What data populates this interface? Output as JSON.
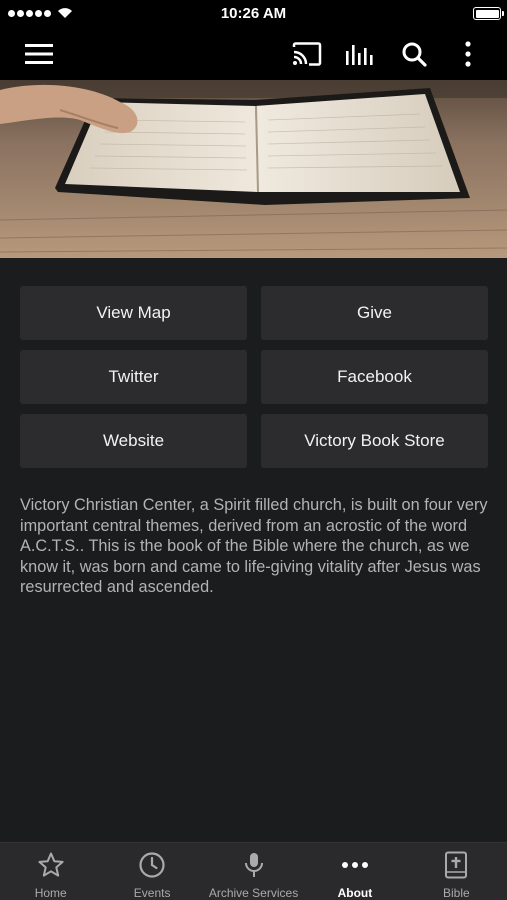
{
  "status_bar": {
    "time": "10:26 AM"
  },
  "toolbar": {
    "icons": [
      "menu-icon",
      "cast-icon",
      "audio-bars-icon",
      "search-icon",
      "more-vertical-icon"
    ]
  },
  "hero": {
    "description": "photo of an open Bible on a wooden table"
  },
  "buttons": [
    {
      "label": "View Map"
    },
    {
      "label": "Give"
    },
    {
      "label": "Twitter"
    },
    {
      "label": "Facebook"
    },
    {
      "label": "Website"
    },
    {
      "label": "Victory Book Store"
    }
  ],
  "about_text": "Victory Christian Center, a Spirit filled church, is built on four very important central themes, derived from an acrostic of the word A.C.T.S..  This is the book of the Bible where the church, as we know it, was born and came to life-giving vitality after Jesus was resurrected and ascended.",
  "tabs": [
    {
      "label": "Home",
      "icon": "star-icon"
    },
    {
      "label": "Events",
      "icon": "clock-icon"
    },
    {
      "label": "Archive Services",
      "icon": "microphone-icon"
    },
    {
      "label": "About",
      "icon": "ellipsis-icon",
      "active": true
    },
    {
      "label": "Bible",
      "icon": "bible-icon"
    }
  ],
  "colors": {
    "background": "#1b1c1e",
    "button": "#2c2c2e",
    "tabbar": "#2a2a2c",
    "text_muted": "#b3b3b3"
  }
}
